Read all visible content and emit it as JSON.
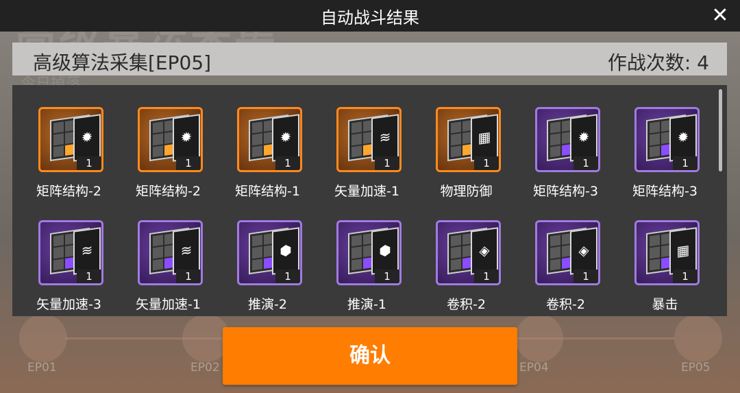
{
  "background": {
    "title": "高级算法采集",
    "subtitle": "今日掉落",
    "ep_labels": [
      "EP01",
      "EP02",
      "EP04",
      "EP05"
    ]
  },
  "header": {
    "title": "自动战斗结果",
    "close_icon": "close-icon"
  },
  "stage": {
    "name": "高级算法采集[EP05]",
    "sortie_label": "作战次数: 4"
  },
  "rewards": [
    {
      "name": "矩阵结构-2",
      "qty": "1",
      "rarity": "orange",
      "glyph": "✹"
    },
    {
      "name": "矩阵结构-2",
      "qty": "1",
      "rarity": "orange",
      "glyph": "✹"
    },
    {
      "name": "矩阵结构-1",
      "qty": "1",
      "rarity": "orange",
      "glyph": "✹"
    },
    {
      "name": "矢量加速-1",
      "qty": "1",
      "rarity": "orange",
      "glyph": "≋"
    },
    {
      "name": "物理防御",
      "qty": "1",
      "rarity": "orange",
      "glyph": "▦"
    },
    {
      "name": "矩阵结构-3",
      "qty": "1",
      "rarity": "purple",
      "glyph": "✹"
    },
    {
      "name": "矩阵结构-3",
      "qty": "1",
      "rarity": "purple",
      "glyph": "✹"
    },
    {
      "name": "矢量加速-3",
      "qty": "1",
      "rarity": "purple",
      "glyph": "≋"
    },
    {
      "name": "矢量加速-1",
      "qty": "1",
      "rarity": "purple",
      "glyph": "≋"
    },
    {
      "name": "推演-2",
      "qty": "1",
      "rarity": "purple",
      "glyph": "⬢"
    },
    {
      "name": "推演-1",
      "qty": "1",
      "rarity": "purple",
      "glyph": "⬢"
    },
    {
      "name": "卷积-2",
      "qty": "1",
      "rarity": "purple",
      "glyph": "◈"
    },
    {
      "name": "卷积-2",
      "qty": "1",
      "rarity": "purple",
      "glyph": "◈"
    },
    {
      "name": "暴击",
      "qty": "1",
      "rarity": "purple",
      "glyph": "▦"
    }
  ],
  "confirm_label": "确认",
  "colors": {
    "accent": "#ff7d00",
    "orange_rarity": "#ff8a1d",
    "purple_rarity": "#a07be0"
  }
}
